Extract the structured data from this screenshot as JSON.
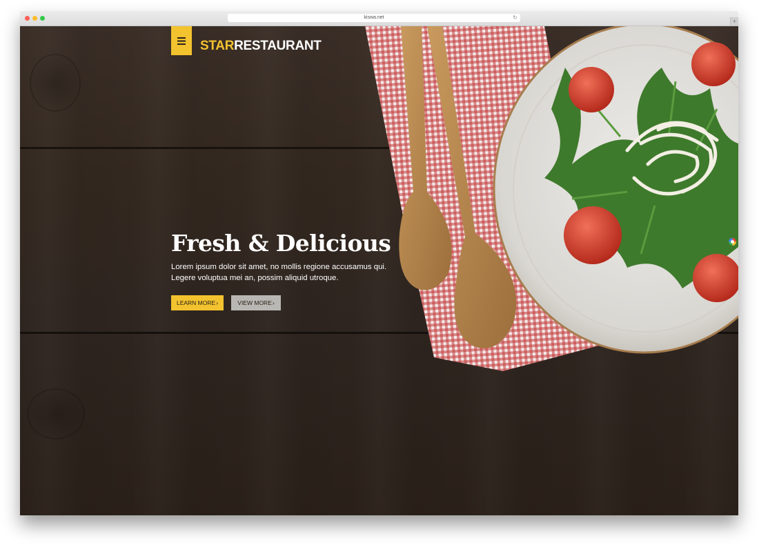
{
  "browser": {
    "url": "kiswa.net",
    "new_tab_symbol": "+",
    "reload_symbol": "↻"
  },
  "header": {
    "brand_part1": "STAR",
    "brand_part2": "RESTAURANT",
    "menu_icon": "hamburger-icon"
  },
  "hero": {
    "title": "Fresh & Delicious",
    "text": "Lorem ipsum dolor sit amet, no mollis regione accusamus qui. Legere voluptua mei an, possim aliquid utroque.",
    "learn_more_label": "LEARN MORE",
    "view_more_label": "VIEW MORE",
    "chevron_symbol": "›"
  },
  "colors": {
    "accent": "#f3c32f",
    "secondary_button": "#b9b7b3",
    "background": "#33281f",
    "text": "#ffffff"
  }
}
